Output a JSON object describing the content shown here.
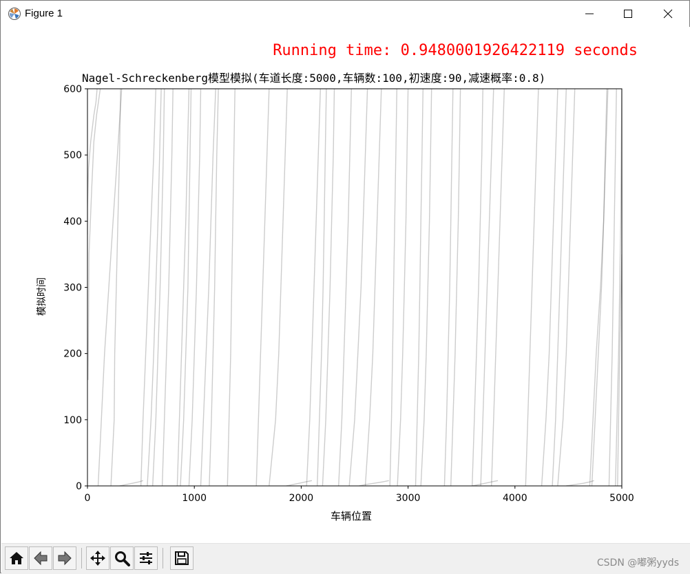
{
  "window": {
    "title": "Figure 1"
  },
  "figure": {
    "runtime_text": "Running time: 0.9480001926422119 seconds",
    "runtime_color": "#ff0000"
  },
  "chart_data": {
    "type": "line",
    "title": "Nagel-Schreckenberg模型模拟(车道长度:5000,车辆数:100,初速度:90,减速概率:0.8)",
    "xlabel": "车辆位置",
    "ylabel": "模拟时间",
    "xlim": [
      0,
      5000
    ],
    "ylim": [
      0,
      600
    ],
    "x_ticks": [
      0,
      1000,
      2000,
      3000,
      4000,
      5000
    ],
    "y_ticks": [
      0,
      100,
      200,
      300,
      400,
      500,
      600
    ],
    "grid": false,
    "line_color": "#000000",
    "line_alpha": 0.2,
    "series": [
      {
        "x": [
          100,
          130,
          160,
          200,
          240,
          280,
          320
        ],
        "y": [
          0,
          100,
          200,
          300,
          400,
          500,
          600
        ]
      },
      {
        "x": [
          5,
          10,
          15,
          40,
          60,
          85,
          120
        ],
        "y": [
          160,
          250,
          350,
          450,
          520,
          560,
          600
        ]
      },
      {
        "x": [
          0,
          0,
          10,
          30,
          60,
          80,
          90
        ],
        "y": [
          380,
          420,
          480,
          520,
          560,
          580,
          600
        ]
      },
      {
        "x": [
          220,
          250,
          255,
          270,
          285,
          300,
          310
        ],
        "y": [
          0,
          100,
          200,
          300,
          400,
          500,
          600
        ]
      },
      {
        "x": [
          500,
          520,
          545,
          570,
          595,
          620,
          640
        ],
        "y": [
          0,
          100,
          200,
          300,
          400,
          500,
          600
        ]
      },
      {
        "x": [
          560,
          595,
          620,
          640,
          660,
          675,
          690
        ],
        "y": [
          0,
          100,
          200,
          300,
          400,
          500,
          600
        ]
      },
      {
        "x": [
          610,
          640,
          660,
          680,
          695,
          710,
          720
        ],
        "y": [
          0,
          100,
          200,
          300,
          400,
          500,
          600
        ]
      },
      {
        "x": [
          700,
          720,
          740,
          760,
          775,
          790,
          800
        ],
        "y": [
          0,
          100,
          200,
          300,
          400,
          500,
          600
        ]
      },
      {
        "x": [
          840,
          860,
          880,
          900,
          920,
          935,
          950
        ],
        "y": [
          0,
          100,
          200,
          300,
          400,
          500,
          600
        ]
      },
      {
        "x": [
          870,
          900,
          920,
          940,
          950,
          960,
          970
        ],
        "y": [
          0,
          100,
          200,
          300,
          400,
          500,
          600
        ]
      },
      {
        "x": [
          950,
          980,
          1000,
          1020,
          1035,
          1050,
          1060
        ],
        "y": [
          0,
          100,
          200,
          300,
          400,
          500,
          600
        ]
      },
      {
        "x": [
          1060,
          1085,
          1110,
          1135,
          1155,
          1175,
          1200
        ],
        "y": [
          0,
          100,
          200,
          300,
          400,
          500,
          600
        ]
      },
      {
        "x": [
          1140,
          1160,
          1175,
          1190,
          1200,
          1210,
          1225
        ],
        "y": [
          0,
          100,
          200,
          300,
          400,
          500,
          600
        ]
      },
      {
        "x": [
          1310,
          1325,
          1340,
          1350,
          1360,
          1370,
          1380
        ],
        "y": [
          0,
          100,
          200,
          300,
          400,
          500,
          600
        ]
      },
      {
        "x": [
          1580,
          1600,
          1620,
          1640,
          1660,
          1680,
          1700
        ],
        "y": [
          0,
          100,
          200,
          300,
          400,
          500,
          600
        ]
      },
      {
        "x": [
          1700,
          1760,
          1790,
          1810,
          1830,
          1850,
          1870
        ],
        "y": [
          0,
          100,
          200,
          300,
          400,
          500,
          600
        ]
      },
      {
        "x": [
          2050,
          2080,
          2100,
          2120,
          2140,
          2160,
          2180
        ],
        "y": [
          0,
          100,
          200,
          300,
          400,
          500,
          600
        ]
      },
      {
        "x": [
          2150,
          2170,
          2190,
          2205,
          2215,
          2225,
          2235
        ],
        "y": [
          0,
          100,
          200,
          300,
          400,
          500,
          600
        ]
      },
      {
        "x": [
          2200,
          2230,
          2250,
          2270,
          2285,
          2300,
          2310
        ],
        "y": [
          0,
          100,
          200,
          300,
          400,
          500,
          600
        ]
      },
      {
        "x": [
          2350,
          2380,
          2400,
          2420,
          2440,
          2455,
          2470
        ],
        "y": [
          0,
          100,
          200,
          300,
          400,
          500,
          600
        ]
      },
      {
        "x": [
          2450,
          2500,
          2530,
          2560,
          2580,
          2600,
          2620
        ],
        "y": [
          0,
          100,
          200,
          300,
          400,
          500,
          600
        ]
      },
      {
        "x": [
          2600,
          2640,
          2670,
          2690,
          2710,
          2730,
          2750
        ],
        "y": [
          0,
          100,
          200,
          300,
          400,
          500,
          600
        ]
      },
      {
        "x": [
          2830,
          2845,
          2855,
          2865,
          2875,
          2885,
          2895
        ],
        "y": [
          0,
          100,
          200,
          300,
          400,
          500,
          600
        ]
      },
      {
        "x": [
          2900,
          2930,
          2950,
          2965,
          2980,
          2990,
          3000
        ],
        "y": [
          0,
          100,
          200,
          300,
          400,
          500,
          600
        ]
      },
      {
        "x": [
          3070,
          3085,
          3100,
          3110,
          3120,
          3130,
          3140
        ],
        "y": [
          0,
          100,
          200,
          300,
          400,
          500,
          600
        ]
      },
      {
        "x": [
          3120,
          3150,
          3170,
          3185,
          3200,
          3210,
          3220
        ],
        "y": [
          0,
          100,
          200,
          300,
          400,
          500,
          600
        ]
      },
      {
        "x": [
          3340,
          3360,
          3375,
          3390,
          3400,
          3410,
          3420
        ],
        "y": [
          0,
          100,
          200,
          300,
          400,
          500,
          600
        ]
      },
      {
        "x": [
          3400,
          3420,
          3440,
          3455,
          3470,
          3480,
          3490
        ],
        "y": [
          0,
          100,
          200,
          300,
          400,
          500,
          600
        ]
      },
      {
        "x": [
          3600,
          3620,
          3640,
          3660,
          3675,
          3690,
          3700
        ],
        "y": [
          0,
          100,
          200,
          300,
          400,
          500,
          600
        ]
      },
      {
        "x": [
          3680,
          3700,
          3720,
          3740,
          3760,
          3780,
          3800
        ],
        "y": [
          0,
          100,
          200,
          300,
          400,
          500,
          600
        ]
      },
      {
        "x": [
          3780,
          3800,
          3820,
          3840,
          3860,
          3880,
          3900
        ],
        "y": [
          0,
          100,
          200,
          300,
          400,
          500,
          600
        ]
      },
      {
        "x": [
          4100,
          4120,
          4140,
          4160,
          4180,
          4200,
          4220
        ],
        "y": [
          0,
          100,
          200,
          300,
          400,
          500,
          600
        ]
      },
      {
        "x": [
          4250,
          4290,
          4320,
          4340,
          4360,
          4380,
          4400
        ],
        "y": [
          0,
          100,
          200,
          300,
          400,
          500,
          600
        ]
      },
      {
        "x": [
          4350,
          4380,
          4400,
          4420,
          4440,
          4460,
          4480
        ],
        "y": [
          0,
          100,
          200,
          300,
          400,
          500,
          600
        ]
      },
      {
        "x": [
          4400,
          4450,
          4480,
          4500,
          4520,
          4540,
          4560
        ],
        "y": [
          0,
          100,
          200,
          300,
          400,
          500,
          600
        ]
      },
      {
        "x": [
          4700,
          4730,
          4760,
          4800,
          4830,
          4850,
          4870
        ],
        "y": [
          0,
          100,
          200,
          300,
          400,
          500,
          600
        ]
      },
      {
        "x": [
          4720,
          4750,
          4780,
          4810,
          4830,
          4845,
          4860
        ],
        "y": [
          0,
          100,
          200,
          300,
          400,
          500,
          600
        ]
      },
      {
        "x": [
          4880,
          4895,
          4910,
          4920,
          4930,
          4940,
          4950
        ],
        "y": [
          0,
          100,
          200,
          300,
          400,
          500,
          600
        ]
      },
      {
        "x": [
          4940,
          4955,
          4970,
          4980,
          4990,
          4995,
          5000
        ],
        "y": [
          0,
          100,
          200,
          300,
          400,
          500,
          600
        ]
      },
      {
        "x": [
          4960,
          4970,
          4980,
          4990,
          5000
        ],
        "y": [
          0,
          100,
          200,
          280,
          350
        ]
      },
      {
        "x": [
          2540,
          2600,
          2680,
          2760,
          2820
        ],
        "y": [
          0,
          2,
          4,
          6,
          8
        ]
      },
      {
        "x": [
          3600,
          3660,
          3720,
          3780,
          3840
        ],
        "y": [
          0,
          2,
          4,
          6,
          8
        ]
      },
      {
        "x": [
          4480,
          4560,
          4640,
          4700,
          4740
        ],
        "y": [
          0,
          2,
          4,
          6,
          8
        ]
      },
      {
        "x": [
          1860,
          1920,
          1980,
          2040,
          2100
        ],
        "y": [
          0,
          2,
          4,
          6,
          8
        ]
      },
      {
        "x": [
          300,
          360,
          420,
          480,
          520
        ],
        "y": [
          0,
          2,
          4,
          6,
          8
        ]
      }
    ]
  },
  "toolbar": {
    "tools": [
      "home-icon",
      "back-icon",
      "forward-icon",
      "pan-icon",
      "zoom-icon",
      "configure-icon",
      "save-icon"
    ]
  },
  "watermark": "CSDN @嘟粥yyds"
}
